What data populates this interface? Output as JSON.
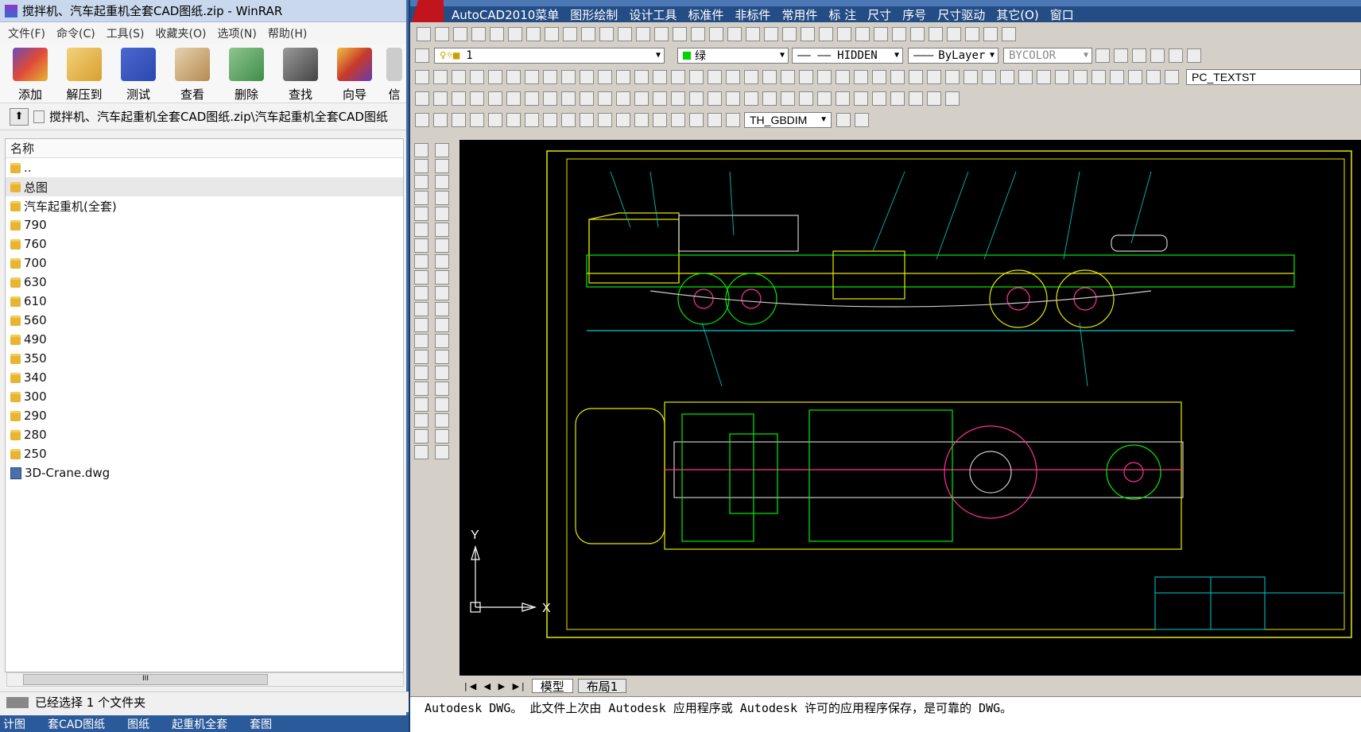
{
  "winrar": {
    "title": "搅拌机、汽车起重机全套CAD图纸.zip - WinRAR",
    "menu": [
      "文件(F)",
      "命令(C)",
      "工具(S)",
      "收藏夹(O)",
      "选项(N)",
      "帮助(H)"
    ],
    "toolbar": [
      "添加",
      "解压到",
      "测试",
      "查看",
      "删除",
      "查找",
      "向导",
      "信"
    ],
    "toolbar_colors": [
      "#6a4bb8",
      "#d8a030",
      "#2a48b0",
      "#b58a50",
      "#3f8e4a",
      "#555555",
      "#c83a2a",
      "#888888"
    ],
    "address": "搅拌机、汽车起重机全套CAD图纸.zip\\汽车起重机全套CAD图纸",
    "list_header": "名称",
    "items": [
      "..",
      "总图",
      "汽车起重机(全套)",
      "790",
      "760",
      "700",
      "630",
      "610",
      "560",
      "490",
      "350",
      "340",
      "300",
      "290",
      "280",
      "250"
    ],
    "file_item": "3D-Crane.dwg",
    "hscroll_grip": "III",
    "status": "已经选择 1 个文件夹"
  },
  "taskbar": [
    "计图",
    "套CAD图纸",
    "图纸",
    "起重机全套",
    "套图"
  ],
  "autocad": {
    "menus": [
      "AutoCAD2010菜单",
      "图形绘制",
      "设计工具",
      "标准件",
      "非标件",
      "常用件",
      "标 注",
      "尺寸",
      "序号",
      "尺寸驱动",
      "其它(O)",
      "窗口"
    ],
    "layer_value": "1",
    "color_value": "绿",
    "linetype_value": "HIDDEN",
    "lineweight_value": "ByLayer",
    "plotstyle_value": "BYCOLOR",
    "textstyle_value": "PC_TEXTST",
    "dimstyle_value": "TH_GBDIM",
    "tabs": [
      "模型",
      "布局1"
    ],
    "command_line": "Autodesk DWG。  此文件上次由 Autodesk 应用程序或 Autodesk 许可的应用程序保存，是可靠的 DWG。",
    "ucs_y": "Y",
    "ucs_x": "X"
  }
}
